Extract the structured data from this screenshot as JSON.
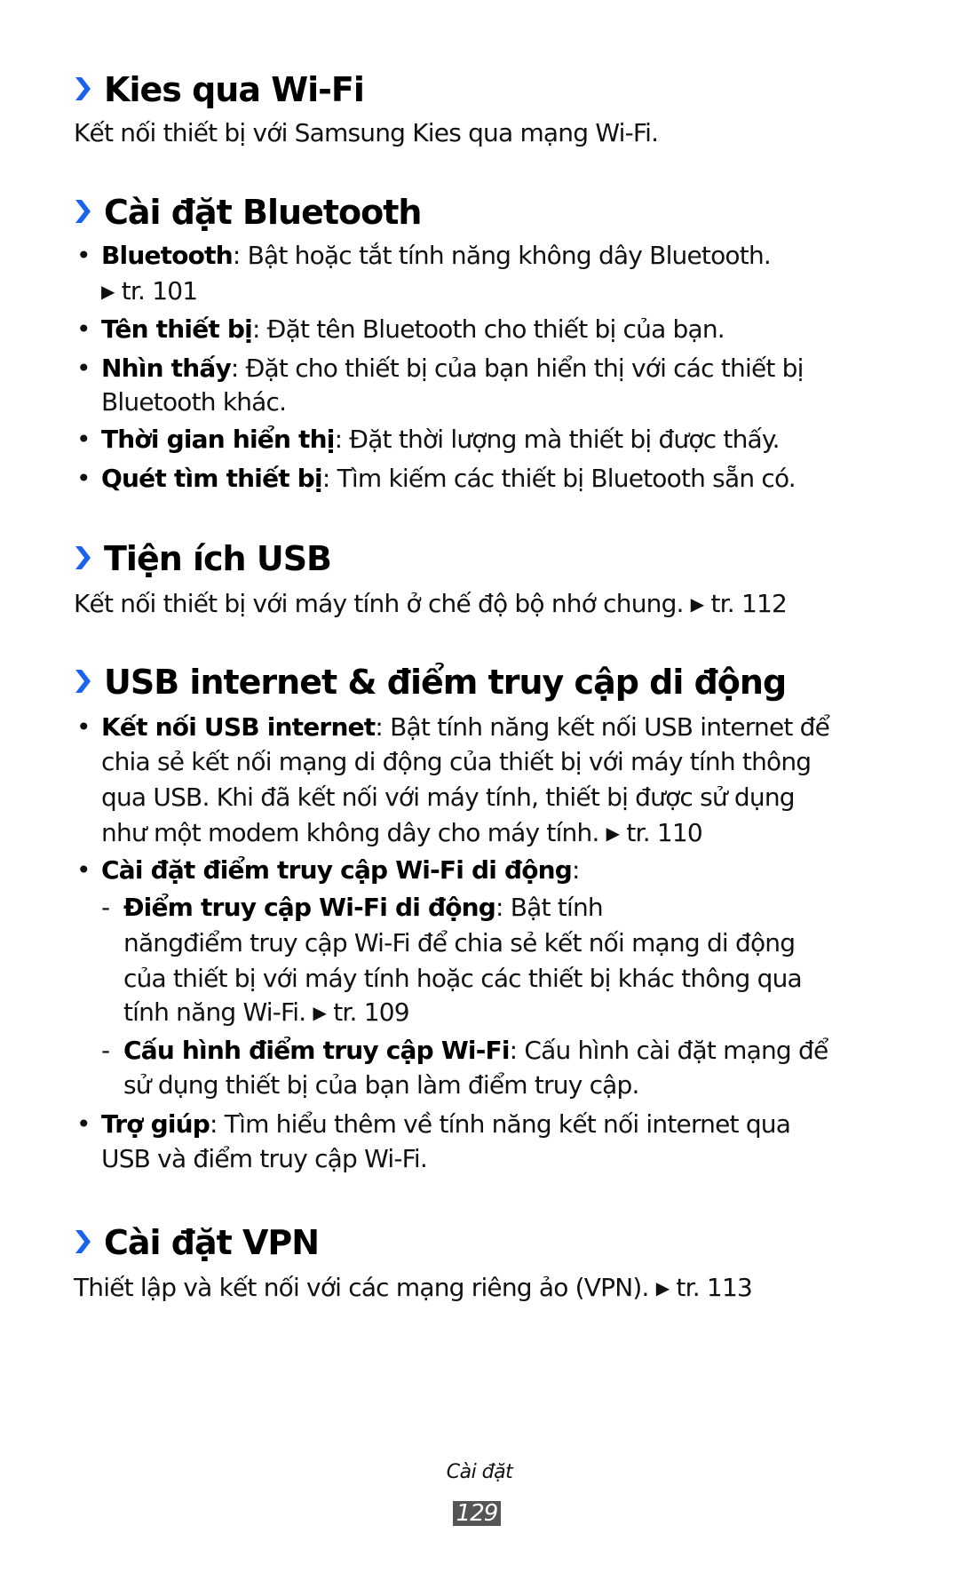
{
  "colors": {
    "accent": "#1a63f0",
    "page_number_bg": "#555555"
  },
  "sections": [
    {
      "title": "Kies qua Wi-Fi",
      "body": "Kết nối thiết bị với Samsung Kies qua mạng Wi-Fi."
    },
    {
      "title": "Cài đặt Bluetooth",
      "items": [
        {
          "term": "Bluetooth",
          "text": ": Bật hoặc tắt tính năng không dây Bluetooth.",
          "cont": "tr. 101"
        },
        {
          "term": "Tên thiết bị",
          "text": ": Đặt tên Bluetooth cho thiết bị của bạn."
        },
        {
          "term": "Nhìn thấy",
          "text": ": Đặt cho thiết bị của bạn hiển thị với các thiết bị",
          "cont": "Bluetooth khác."
        },
        {
          "term": "Thời gian hiển thị",
          "text": ": Đặt thời lượng mà thiết bị được thấy."
        },
        {
          "term": "Quét tìm thiết bị",
          "text": ": Tìm kiếm các thiết bị Bluetooth sẵn có."
        }
      ]
    },
    {
      "title": "Tiện ích USB",
      "body": "Kết nối thiết bị với máy tính ở chế độ bộ nhớ chung.",
      "ref": "tr. 112"
    },
    {
      "title": "USB internet & điểm truy cập di động",
      "items": [
        {
          "term": "Kết nối USB internet",
          "text": ": Bật tính năng kết nối USB internet để",
          "lines": [
            "chia sẻ kết nối mạng di động của thiết bị với máy tính thông",
            "qua USB. Khi đã kết nối với máy tính, thiết bị được sử dụng",
            "như một modem không dây cho máy tính."
          ],
          "ref": "tr. 110"
        },
        {
          "term": "Cài đặt điểm truy cập Wi-Fi di động",
          "text": ":",
          "subitems": [
            {
              "term": "Điểm truy cập Wi-Fi di động",
              "text": ": Bật tính",
              "lines": [
                "năngđiểm truy cập Wi-Fi để chia sẻ kết nối mạng di động",
                "của thiết bị với máy tính hoặc các thiết bị khác thông qua",
                "tính năng Wi-Fi."
              ],
              "ref": "tr. 109"
            },
            {
              "term": "Cấu hình điểm truy cập Wi-Fi",
              "text": ": Cấu hình cài đặt mạng để",
              "lines": [
                "sử dụng thiết bị của bạn làm điểm truy cập."
              ]
            }
          ]
        },
        {
          "term": "Trợ giúp",
          "text": ": Tìm hiểu thêm về tính năng kết nối internet qua",
          "lines": [
            "USB và điểm truy cập Wi-Fi."
          ]
        }
      ]
    },
    {
      "title": "Cài đặt VPN",
      "body": "Thiết lập và kết nối với các mạng riêng ảo (VPN).",
      "ref": "tr. 113"
    }
  ],
  "symbols": {
    "ref_arrow": "▶",
    "bullet": "•",
    "dash": "-"
  },
  "footer": {
    "chapter": "Cài đặt",
    "page_number": "129"
  }
}
